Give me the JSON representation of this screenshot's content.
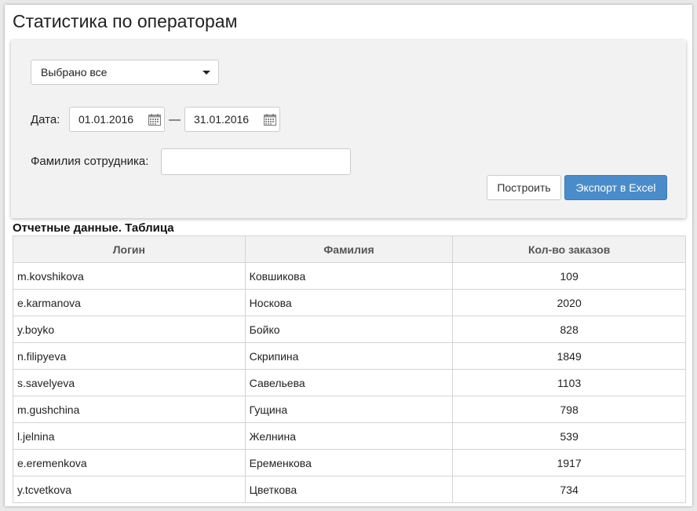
{
  "page": {
    "title": "Статистика по операторам"
  },
  "filters": {
    "selection": "Выбрано все",
    "date_label": "Дата:",
    "date_from": "01.01.2016",
    "date_separator": "—",
    "date_to": "31.01.2016",
    "surname_label": "Фамилия сотрудника:",
    "surname_value": ""
  },
  "actions": {
    "build_label": "Построить",
    "export_label": "Экспорт в Excel"
  },
  "colors": {
    "primary": "#4a8cc9",
    "panel": "#f2f2f2"
  },
  "report": {
    "caption": "Отчетные данные. Таблица",
    "columns": [
      "Логин",
      "Фамилия",
      "Кол-во заказов"
    ],
    "rows": [
      {
        "login": "m.kovshikova",
        "surname": "Ковшикова",
        "orders": "109"
      },
      {
        "login": "e.karmanova",
        "surname": "Носкова",
        "orders": "2020"
      },
      {
        "login": "y.boyko",
        "surname": "Бойко",
        "orders": "828"
      },
      {
        "login": "n.filipyeva",
        "surname": "Скрипина",
        "orders": "1849"
      },
      {
        "login": "s.savelyeva",
        "surname": "Савельева",
        "orders": "1103"
      },
      {
        "login": "m.gushchina",
        "surname": "Гущина",
        "orders": "798"
      },
      {
        "login": "l.jelnina",
        "surname": "Желнина",
        "orders": "539"
      },
      {
        "login": "e.eremenkova",
        "surname": "Еременкова",
        "orders": "1917"
      },
      {
        "login": "y.tcvetkova",
        "surname": "Цветкова",
        "orders": "734"
      }
    ]
  }
}
